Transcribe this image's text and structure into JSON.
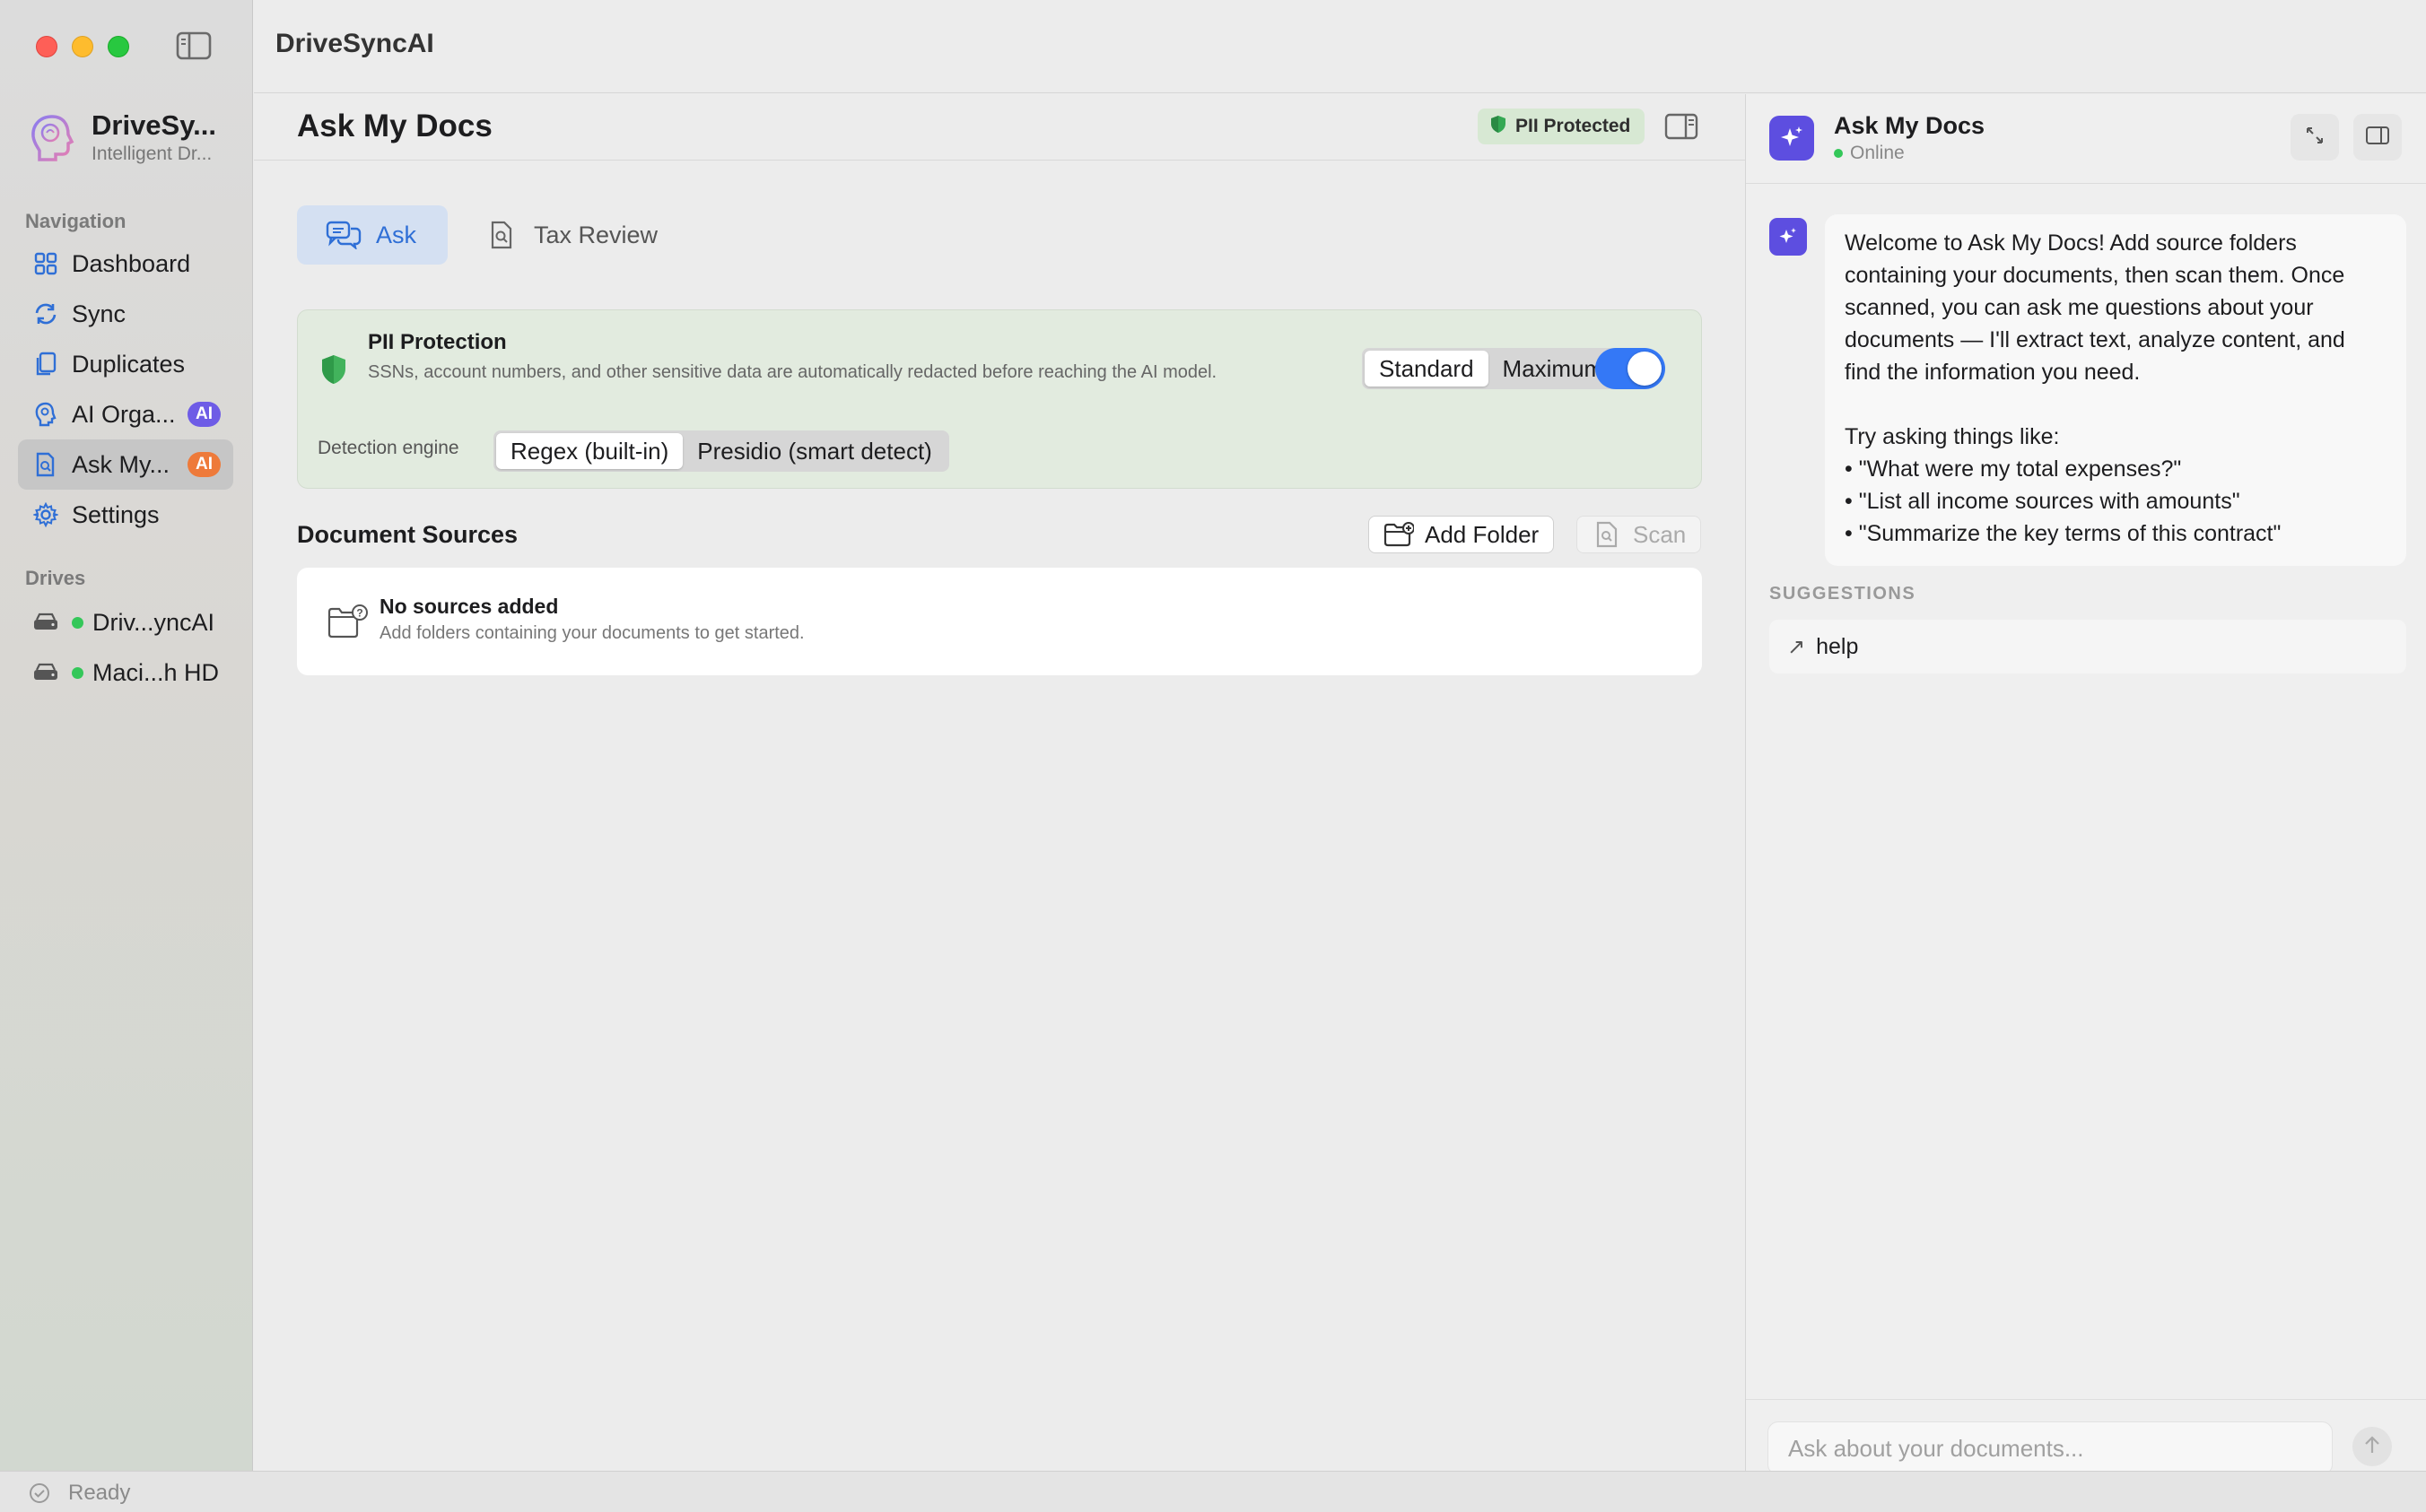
{
  "window": {
    "app_title": "DriveSyncAI",
    "status": "Ready"
  },
  "sidebar": {
    "brand_name": "DriveSy...",
    "brand_sub": "Intelligent Dr...",
    "nav_label": "Navigation",
    "items": [
      {
        "label": "Dashboard",
        "icon": "grid-icon"
      },
      {
        "label": "Sync",
        "icon": "sync-icon"
      },
      {
        "label": "Duplicates",
        "icon": "duplicates-icon"
      },
      {
        "label": "AI Orga...",
        "icon": "ai-head-icon",
        "badge": "AI",
        "badge_color": "#6e5ce6"
      },
      {
        "label": "Ask My...",
        "icon": "doc-search-icon",
        "badge": "AI",
        "badge_color": "#ee7a3a",
        "active": true
      },
      {
        "label": "Settings",
        "icon": "gear-icon"
      }
    ],
    "drives_label": "Drives",
    "drives": [
      {
        "label": "Driv...yncAI",
        "status_color": "#34c759"
      },
      {
        "label": "Maci...h HD",
        "status_color": "#34c759"
      }
    ]
  },
  "main": {
    "title": "Ask My Docs",
    "pii_badge": "PII Protected",
    "tabs": [
      {
        "label": "Ask",
        "active": true
      },
      {
        "label": "Tax Review",
        "active": false
      }
    ],
    "pii": {
      "title": "PII Protection",
      "description": "SSNs, account numbers, and other sensitive data are automatically redacted before reaching the AI model.",
      "modes": [
        "Standard",
        "Maximum"
      ],
      "selected_mode": "Standard",
      "enabled": true,
      "engine_label": "Detection engine",
      "engines": [
        "Regex (built-in)",
        "Presidio (smart detect)"
      ],
      "selected_engine": "Regex (built-in)"
    },
    "sources": {
      "title": "Document Sources",
      "add_label": "Add Folder",
      "scan_label": "Scan",
      "empty_title": "No sources added",
      "empty_sub": "Add folders containing your documents to get started."
    }
  },
  "chat": {
    "name": "Ask My Docs",
    "status": "Online",
    "welcome": "Welcome to Ask My Docs! Add source folders containing your documents, then scan them. Once scanned, you can ask me questions about your documents — I'll extract text, analyze content, and find the information you need.\n\nTry asking things like:\n• \"What were my total expenses?\"\n• \"List all income sources with amounts\"\n• \"Summarize the key terms of this contract\"",
    "suggestions_label": "SUGGESTIONS",
    "suggestions": [
      "help"
    ],
    "input_placeholder": "Ask about your documents..."
  },
  "colors": {
    "accent": "#3478f6",
    "assistant": "#5d4ee0",
    "pii_card": "#e2ebdf",
    "online": "#34c759"
  }
}
